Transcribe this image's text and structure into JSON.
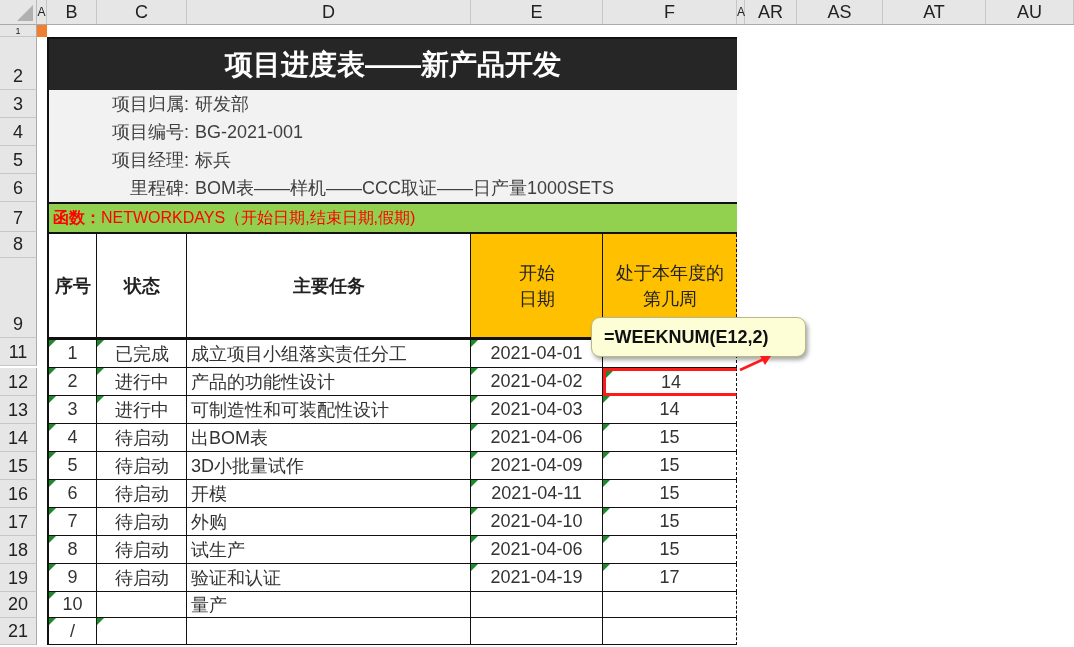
{
  "column_headers": [
    "A",
    "B",
    "C",
    "D",
    "E",
    "F",
    "A",
    "AR",
    "AS",
    "AT",
    "AU"
  ],
  "row_headers": [
    "1",
    "2",
    "3",
    "4",
    "5",
    "6",
    "7",
    "8",
    "9",
    "11",
    "12",
    "13",
    "14",
    "15",
    "16",
    "17",
    "18",
    "19",
    "20",
    "21"
  ],
  "title": "项目进度表——新产品开发",
  "info": [
    {
      "label": "项目归属:",
      "value": "研发部"
    },
    {
      "label": "项目编号:",
      "value": "BG-2021-001"
    },
    {
      "label": "项目经理:",
      "value": "标兵"
    },
    {
      "label": "里程碑:",
      "value": "BOM表——样机——CCC取证——日产量1000SETS"
    }
  ],
  "function_note": "**函数：**NETWORKDAYS（开始日期,结束日期,假期)",
  "table": {
    "columns": [
      {
        "lines": [
          "序号"
        ]
      },
      {
        "lines": [
          "状态"
        ]
      },
      {
        "lines": [
          "主要任务"
        ]
      },
      {
        "lines": [
          "开始",
          "日期"
        ]
      },
      {
        "lines": [
          "处于本年度的",
          "第几周"
        ]
      }
    ],
    "rows": [
      {
        "no": "1",
        "status": "已完成",
        "task": "成立项目小组落实责任分工",
        "start": "2021-04-01",
        "no_flag": true,
        "status_flag": true,
        "start_flag": true,
        "week_flag": false,
        "highlighted": false
      },
      {
        "no": "2",
        "status": "进行中",
        "task": "产品的功能性设计",
        "start": "2021-04-02",
        "week": "14",
        "no_flag": true,
        "status_flag": true,
        "start_flag": true,
        "week_flag": true,
        "highlighted": true
      },
      {
        "no": "3",
        "status": "进行中",
        "task": "可制造性和可装配性设计",
        "start": "2021-04-03",
        "week": "14",
        "no_flag": true,
        "status_flag": true,
        "start_flag": true,
        "week_flag": true,
        "highlighted": false
      },
      {
        "no": "4",
        "status": "待启动",
        "task": "出BOM表",
        "start": "2021-04-06",
        "week": "15",
        "no_flag": true,
        "status_flag": false,
        "start_flag": true,
        "week_flag": true,
        "highlighted": false
      },
      {
        "no": "5",
        "status": "待启动",
        "task": "3D小批量试作",
        "start": "2021-04-09",
        "week": "15",
        "no_flag": true,
        "status_flag": false,
        "start_flag": true,
        "week_flag": true,
        "highlighted": false
      },
      {
        "no": "6",
        "status": "待启动",
        "task": "开模",
        "start": "2021-04-11",
        "week": "15",
        "no_flag": true,
        "status_flag": false,
        "start_flag": true,
        "week_flag": true,
        "highlighted": false
      },
      {
        "no": "7",
        "status": "待启动",
        "task": "外购",
        "start": "2021-04-10",
        "week": "15",
        "no_flag": true,
        "status_flag": false,
        "start_flag": true,
        "week_flag": true,
        "highlighted": false
      },
      {
        "no": "8",
        "status": "待启动",
        "task": "试生产",
        "start": "2021-04-06",
        "week": "15",
        "no_flag": true,
        "status_flag": false,
        "start_flag": true,
        "week_flag": true,
        "highlighted": false
      },
      {
        "no": "9",
        "status": "待启动",
        "task": "验证和认证",
        "start": "2021-04-19",
        "week": "17",
        "no_flag": true,
        "status_flag": false,
        "start_flag": true,
        "week_flag": true,
        "highlighted": false
      },
      {
        "no": "10",
        "task": "量产",
        "no_flag": true,
        "status_flag": false,
        "start_flag": false,
        "week_flag": false,
        "highlighted": false
      },
      {
        "no": "/",
        "no_flag": true,
        "status_flag": true,
        "start_flag": false,
        "week_flag": false,
        "highlighted": false
      }
    ]
  },
  "callout": {
    "text": "=WEEKNUM(E12,2)"
  }
}
